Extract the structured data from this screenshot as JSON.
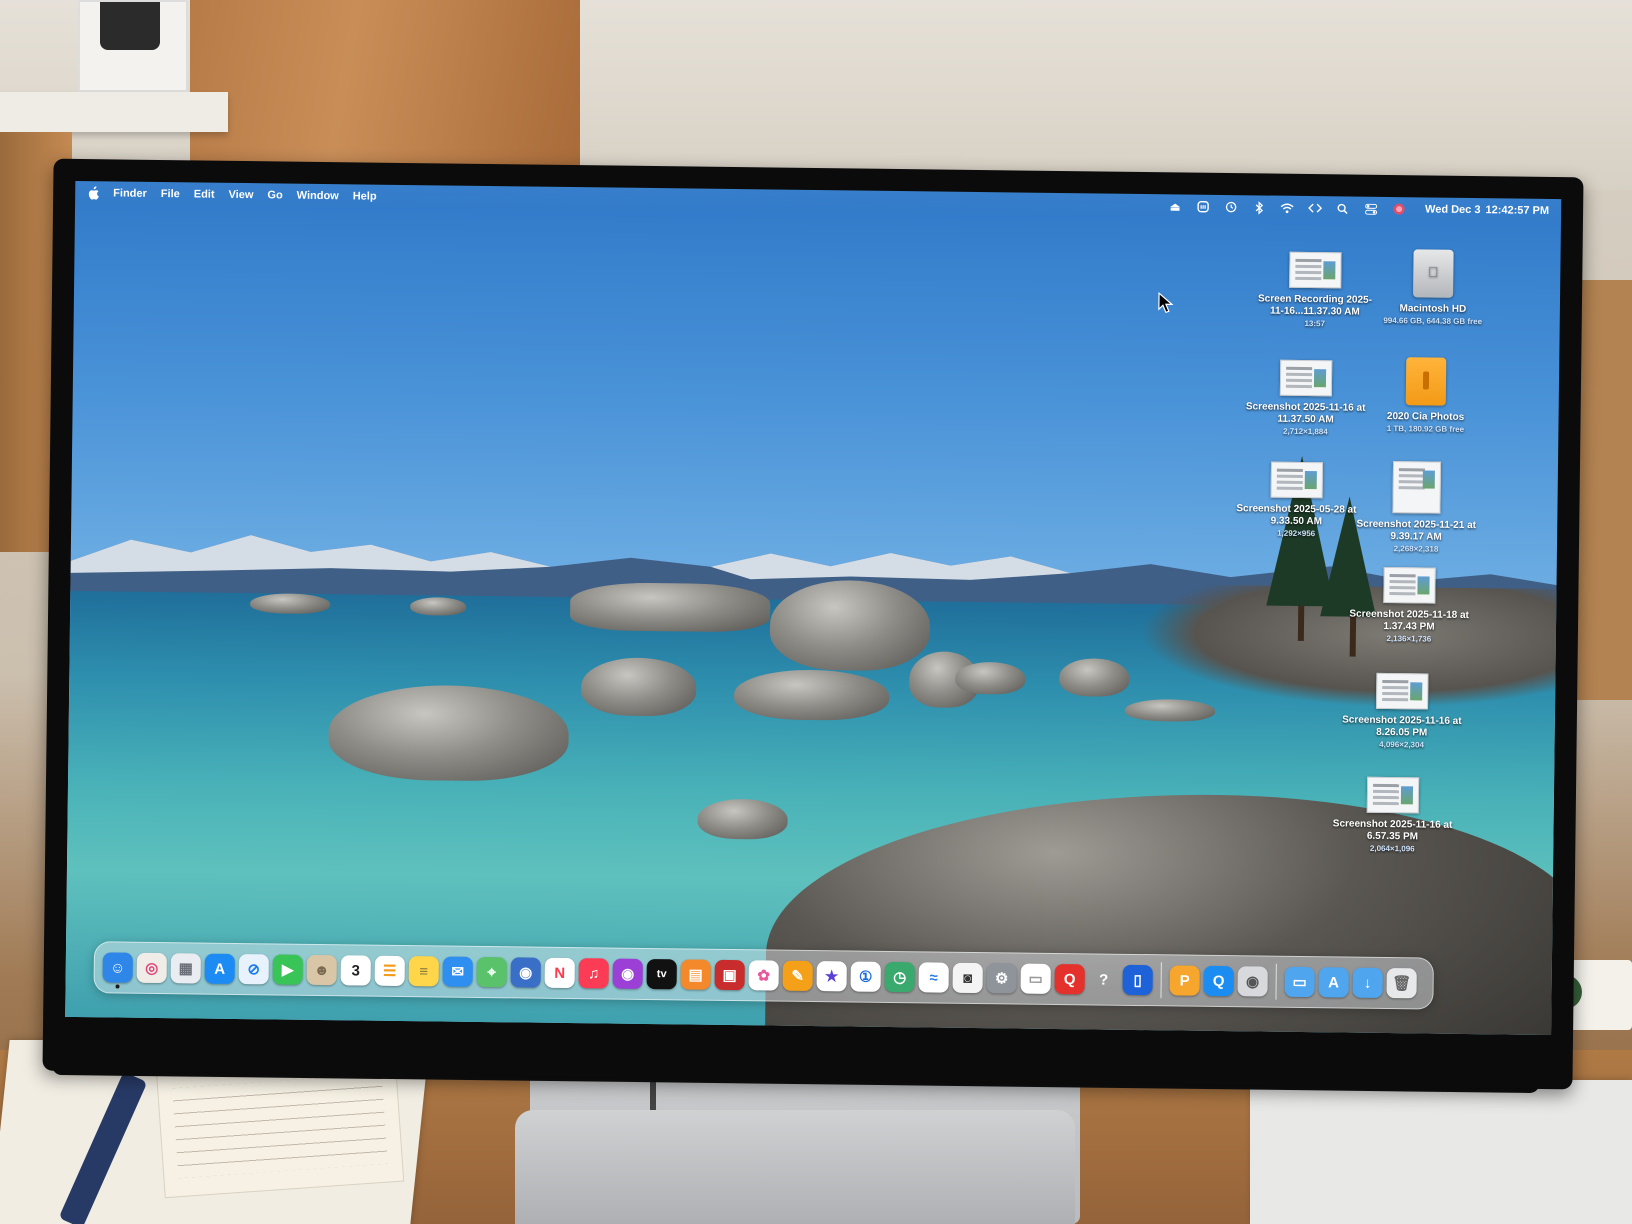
{
  "menubar": {
    "apple": "apple-menu",
    "app_name": "Finder",
    "items": [
      "File",
      "Edit",
      "View",
      "Go",
      "Window",
      "Help"
    ],
    "clock_date": "Wed Dec 3",
    "clock_time": "12:42:57 PM",
    "status_icons": [
      "eject-icon",
      "mastodon-icon",
      "timemachine-icon",
      "bluetooth-icon",
      "wifi-icon",
      "code-icon",
      "search-icon",
      "control-center-icon",
      "siri-icon"
    ]
  },
  "desktop_icons": [
    {
      "id": "screen-recording",
      "name": "Screen Recording 2025-11-16...11.37.30 AM",
      "meta": "13:57",
      "kind": "doc"
    },
    {
      "id": "macintosh-hd",
      "name": "Macintosh HD",
      "meta": "994.66 GB, 644.38 GB free",
      "kind": "hd"
    },
    {
      "id": "screenshot-1",
      "name": "Screenshot 2025-11-16 at 11.37.50 AM",
      "meta": "2,712×1,884",
      "kind": "doc"
    },
    {
      "id": "cia-photos",
      "name": "2020 Cia Photos",
      "meta": "1 TB, 180.92 GB free",
      "kind": "ext"
    },
    {
      "id": "screenshot-2",
      "name": "Screenshot 2025-05-28 at 9.33.50 AM",
      "meta": "1,292×956",
      "kind": "doc"
    },
    {
      "id": "screenshot-3",
      "name": "Screenshot 2025-11-21 at 9.39.17 AM",
      "meta": "2,268×2,318",
      "kind": "portrait"
    },
    {
      "id": "screenshot-4",
      "name": "Screenshot 2025-11-18 at 1.37.43 PM",
      "meta": "2,136×1,736",
      "kind": "doc"
    },
    {
      "id": "screenshot-5",
      "name": "Screenshot 2025-11-16 at 8.26.05 PM",
      "meta": "4,096×2,304",
      "kind": "doc"
    },
    {
      "id": "screenshot-6",
      "name": "Screenshot 2025-11-16 at 6.57.35 PM",
      "meta": "2,064×1,096",
      "kind": "doc"
    }
  ],
  "dock": {
    "apps": [
      {
        "name": "finder",
        "color": "#2f86e9",
        "glyph": "☺",
        "running": true
      },
      {
        "name": "safari-alt",
        "color": "#f0ede8",
        "glyph": "◎",
        "fg": "#e0457b"
      },
      {
        "name": "launchpad",
        "color": "#e9ecf1",
        "glyph": "▦",
        "fg": "#6a6f78"
      },
      {
        "name": "app-store",
        "color": "#1c8cf4",
        "glyph": "A"
      },
      {
        "name": "safari",
        "color": "#e8f2fd",
        "glyph": "⊘",
        "fg": "#1b7bf0"
      },
      {
        "name": "facetime",
        "color": "#38c456",
        "glyph": "▶"
      },
      {
        "name": "contacts",
        "color": "#d9c6a6",
        "glyph": "☻",
        "fg": "#7b6a52"
      },
      {
        "name": "calendar",
        "color": "#ffffff",
        "glyph": "3",
        "fg": "#222"
      },
      {
        "name": "reminders",
        "color": "#ffffff",
        "glyph": "☰",
        "fg": "#f39a17"
      },
      {
        "name": "notes",
        "color": "#ffd649",
        "glyph": "≡",
        "fg": "#8a7a3c"
      },
      {
        "name": "mail",
        "color": "#2f8ff0",
        "glyph": "✉"
      },
      {
        "name": "maps",
        "color": "#5ac26a",
        "glyph": "⌖"
      },
      {
        "name": "mission",
        "color": "#3a6fc7",
        "glyph": "◉"
      },
      {
        "name": "news",
        "color": "#ffffff",
        "glyph": "N",
        "fg": "#ff3b4e"
      },
      {
        "name": "music",
        "color": "#fc3c55",
        "glyph": "♫"
      },
      {
        "name": "podcasts",
        "color": "#9b3fd6",
        "glyph": "◉"
      },
      {
        "name": "apple-tv",
        "color": "#111111",
        "glyph": "tv"
      },
      {
        "name": "books",
        "color": "#f3892a",
        "glyph": "▤"
      },
      {
        "name": "photo-booth",
        "color": "#c92c2c",
        "glyph": "▣"
      },
      {
        "name": "photos",
        "color": "#ffffff",
        "glyph": "✿",
        "fg": "#e55a9c"
      },
      {
        "name": "pages",
        "color": "#f5a019",
        "glyph": "✎"
      },
      {
        "name": "imovie",
        "color": "#ffffff",
        "glyph": "★",
        "fg": "#5b3fd6"
      },
      {
        "name": "1password",
        "color": "#ffffff",
        "glyph": "①",
        "fg": "#1a6de0"
      },
      {
        "name": "time-machine",
        "color": "#3aa96d",
        "glyph": "◷"
      },
      {
        "name": "wifi-diagnostics",
        "color": "#ffffff",
        "glyph": "≈",
        "fg": "#2a7be4"
      },
      {
        "name": "screenshot",
        "color": "#f4f4f4",
        "glyph": "◙",
        "fg": "#333"
      },
      {
        "name": "system-settings",
        "color": "#8f949a",
        "glyph": "⚙"
      },
      {
        "name": "textedit",
        "color": "#ffffff",
        "glyph": "▭",
        "fg": "#999"
      },
      {
        "name": "quicktime-red",
        "color": "#e4312b",
        "glyph": "Q"
      },
      {
        "name": "help",
        "color": "transparent",
        "glyph": "?",
        "fg": "#fff"
      },
      {
        "name": "iphone-mirroring",
        "color": "#1d62d8",
        "glyph": "▯"
      }
    ],
    "right_apps": [
      {
        "name": "pixelmator",
        "color": "#f6a52d",
        "glyph": "P"
      },
      {
        "name": "quicktime",
        "color": "#1b8df2",
        "glyph": "Q"
      },
      {
        "name": "disk-utility",
        "color": "#d7d9dc",
        "glyph": "◉",
        "fg": "#555"
      }
    ],
    "folders": [
      {
        "name": "documents-folder",
        "color": "#4fa6ee",
        "glyph": "▭"
      },
      {
        "name": "applications-folder",
        "color": "#4fa6ee",
        "glyph": "A"
      },
      {
        "name": "downloads-folder",
        "color": "#4fa6ee",
        "glyph": "↓"
      },
      {
        "name": "trash",
        "color": "#e6e8ea",
        "glyph": "🗑",
        "fg": "#666"
      }
    ]
  }
}
